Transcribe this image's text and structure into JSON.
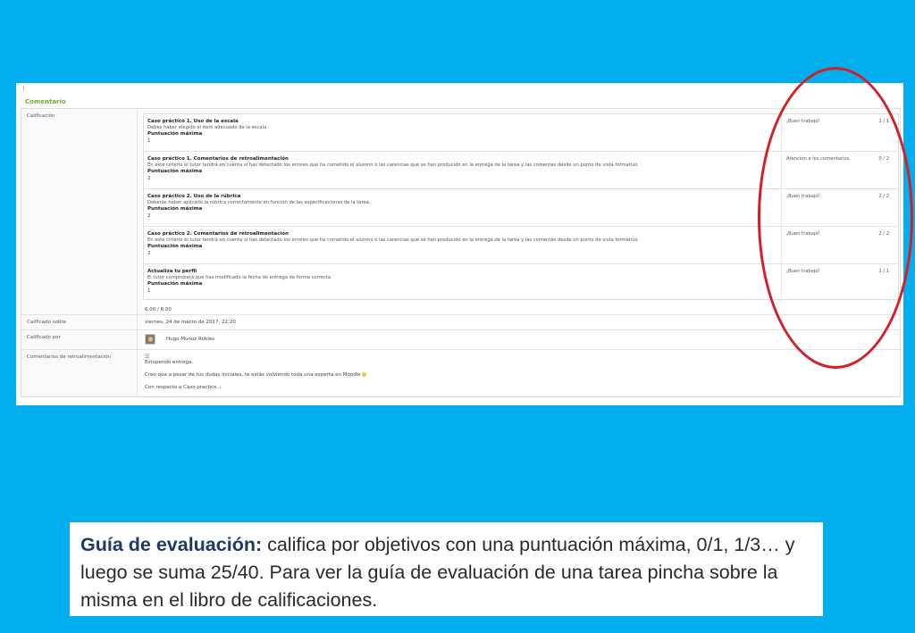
{
  "screenshot": {
    "section_title": "Comentario",
    "rows": {
      "calificacion_label": "Calificación",
      "total_score": "6,00 / 8,00",
      "calificado_sobre_label": "Calificado sobre",
      "calificado_sobre_value": "viernes, 24 de marzo de 2017, 22:20",
      "calificado_por_label": "Calificado por",
      "calificado_por_value": "Hugo Munoz Robles",
      "comentarios_label": "Comentarios de retroalimentación",
      "comentarios_lines": [
        "Estupendo entrega.",
        "Creo que a pesar de tus dudas iniciales, te estás volviendo toda una experta en Moodle",
        "Con respecto a Caso practico..."
      ]
    },
    "criteria": [
      {
        "title": "Caso práctico 1. Uso de la escala",
        "description": "Debes haber elegido el item adecuado de la escala",
        "max_label": "Puntuación máxima",
        "max_value": "1",
        "feedback": "¡Buen trabajo!",
        "score": "1 / 1"
      },
      {
        "title": "Caso práctico 1. Comentarios de retroalimentación",
        "description": "En este criterio el tutor tendrá en cuenta si has detectado los errores que ha cometido el alumno o las carencias que se han producido en la entrega de la tarea y las comentas desde un punto de vista formativo.",
        "max_label": "Puntuación máxima",
        "max_value": "2",
        "feedback": "Atención a los comentarios",
        "score": "0 / 2"
      },
      {
        "title": "Caso práctico 2. Uso de la rúbrica",
        "description": "Deberás haber aplicado la rúbrica correctamente en función de las especificaciones de la tarea.",
        "max_label": "Puntuación máxima",
        "max_value": "2",
        "feedback": "¡Buen trabajo!",
        "score": "2 / 2"
      },
      {
        "title": "Caso práctico 2. Comentarios de retroalimentación",
        "description": "En este criterio el tutor tendrá en cuenta si has detectado los errores que ha cometido el alumno o las carencias que se han producido en la entrega de la tarea y las comentas desde un punto de vista formativo.",
        "max_label": "Puntuación máxima",
        "max_value": "2",
        "feedback": "¡Buen trabajo!",
        "score": "2 / 2"
      },
      {
        "title": "Actualiza tu perfil",
        "description": "El tutor comprobará que has modificado la fecha de entrega de forma correcta.",
        "max_label": "Puntuación máxima",
        "max_value": "1",
        "feedback": "¡Buen trabajo!",
        "score": "1 / 1"
      }
    ]
  },
  "caption": {
    "bold": "Guía de evaluación:",
    "text": " califica por objetivos con una puntuación máxima, 0/1, 1/3… y luego se suma 25/40. Para ver la guía de evaluación de una tarea pincha sobre la misma en el libro de calificaciones."
  },
  "colors": {
    "background": "#03aeef",
    "highlight": "#d51f27",
    "section_title": "#7aa92b"
  }
}
